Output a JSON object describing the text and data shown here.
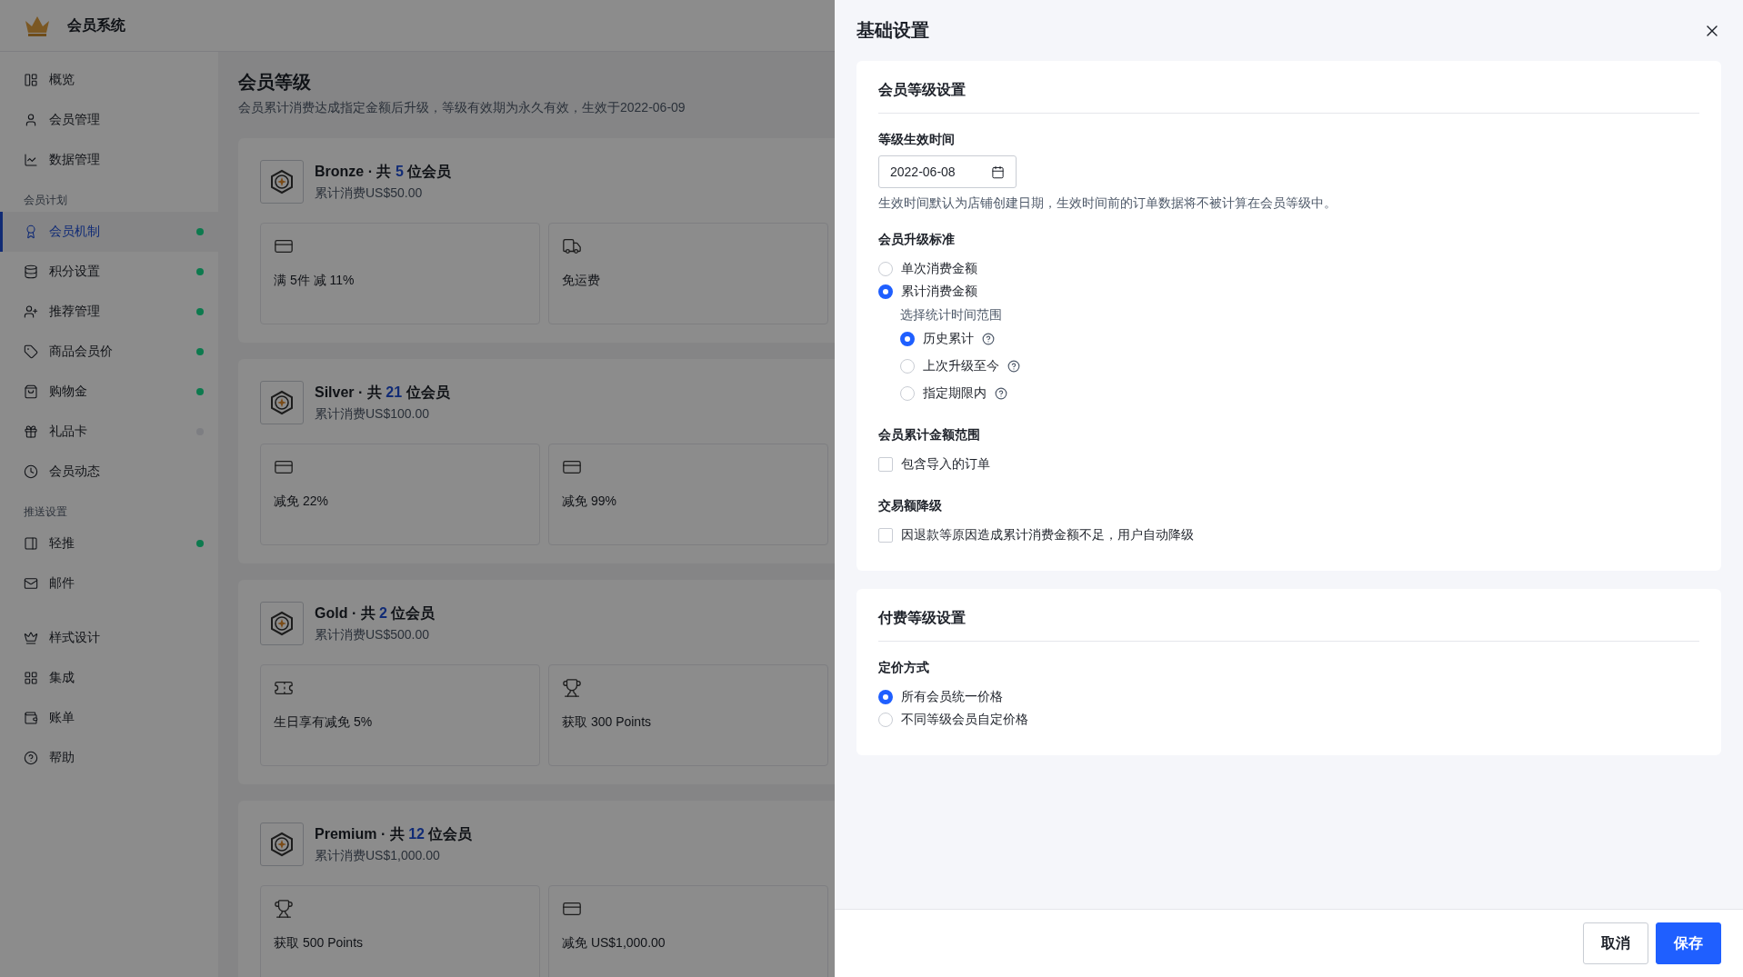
{
  "app": {
    "title": "会员系统"
  },
  "sidebar": {
    "groups": [
      {
        "items": [
          {
            "label": "概览",
            "selected": false
          },
          {
            "label": "会员管理",
            "selected": false
          },
          {
            "label": "数据管理",
            "selected": false
          }
        ]
      },
      {
        "title": "会员计划",
        "items": [
          {
            "label": "会员机制",
            "selected": true,
            "color": "#0d7a4e"
          },
          {
            "label": "积分设置",
            "selected": false,
            "color": "#0d7a4e"
          },
          {
            "label": "推荐管理",
            "selected": false,
            "color": "#0d7a4e"
          },
          {
            "label": "商品会员价",
            "selected": false,
            "color": "#0d7a4e"
          },
          {
            "label": "购物金",
            "selected": false,
            "color": "#0d7a4e"
          },
          {
            "label": "礼品卡",
            "selected": false,
            "color": "#7d7e82"
          },
          {
            "label": "会员动态",
            "selected": false
          }
        ]
      },
      {
        "title": "推送设置",
        "items": [
          {
            "label": "轻推",
            "selected": false,
            "color": "#0d7a4e"
          },
          {
            "label": "邮件",
            "selected": false
          }
        ]
      },
      {
        "items": [
          {
            "label": "样式设计",
            "selected": false
          },
          {
            "label": "集成",
            "selected": false
          },
          {
            "label": "账单",
            "selected": false
          },
          {
            "label": "帮助",
            "selected": false
          }
        ]
      }
    ]
  },
  "page": {
    "title": "会员等级",
    "subtitle": "会员累计消费达成指定金额后升级，等级有效期为永久有效，生效于2022-06-09"
  },
  "tiers": [
    {
      "name": "Bronze · 共",
      "count": "5",
      "suffix": "位会员",
      "spend": "累计消费US$50.00",
      "benefits": [
        {
          "kind": "discount",
          "text": "满 5件 减 11%"
        },
        {
          "kind": "shipping",
          "text": "免运费"
        }
      ]
    },
    {
      "name": "Silver · 共",
      "count": "21",
      "suffix": "位会员",
      "spend": "累计消费US$100.00",
      "benefits": [
        {
          "kind": "discount",
          "text": "减免 22%"
        },
        {
          "kind": "discount",
          "text": "减免 99%"
        }
      ]
    },
    {
      "name": "Gold · 共",
      "count": "2",
      "suffix": "位会员",
      "spend": "累计消费US$500.00",
      "benefits": [
        {
          "kind": "coupon",
          "text": "生日享有减免 5%"
        },
        {
          "kind": "points",
          "text": "获取 300 Points"
        }
      ]
    },
    {
      "name": "Premium · 共",
      "count": "12",
      "suffix": "位会员",
      "spend": "累计消费US$1,000.00",
      "benefits": [
        {
          "kind": "points",
          "text": "获取 500 Points"
        },
        {
          "kind": "discount",
          "text": "减免 US$1,000.00"
        }
      ]
    }
  ],
  "drawer": {
    "title": "基础设置",
    "sections": [
      {
        "title": "会员等级设置",
        "fields": [
          {
            "kind": "date",
            "label": "等级生效时间",
            "value": "2022-06-08",
            "hint": "生效时间默认为店铺创建日期，生效时间前的订单数据将不被计算在会员等级中。"
          },
          {
            "kind": "radio",
            "label": "会员升级标准",
            "options": [
              {
                "label": "单次消费金额",
                "selected": false
              },
              {
                "label": "累计消费金额",
                "selected": true,
                "sub": {
                  "label": "选择统计时间范围",
                  "options": [
                    {
                      "label": "历史累计",
                      "selected": true,
                      "help": true
                    },
                    {
                      "label": "上次升级至今",
                      "selected": false,
                      "help": true
                    },
                    {
                      "label": "指定期限内",
                      "selected": false,
                      "help": true
                    }
                  ]
                }
              }
            ]
          },
          {
            "kind": "checkbox",
            "label": "会员累计金额范围",
            "options": [
              {
                "label": "包含导入的订单",
                "checked": false
              }
            ]
          },
          {
            "kind": "checkbox",
            "label": "交易额降级",
            "options": [
              {
                "label": "因退款等原因造成累计消费金额不足，用户自动降级",
                "checked": false
              }
            ]
          }
        ]
      },
      {
        "title": "付费等级设置",
        "fields": [
          {
            "kind": "radio",
            "label": "定价方式",
            "options": [
              {
                "label": "所有会员统一价格",
                "selected": true
              },
              {
                "label": "不同等级会员自定价格",
                "selected": false
              }
            ]
          }
        ]
      }
    ],
    "buttons": [
      {
        "label": "取消",
        "kind": "secondary"
      },
      {
        "label": "保存",
        "kind": "primary"
      }
    ]
  }
}
